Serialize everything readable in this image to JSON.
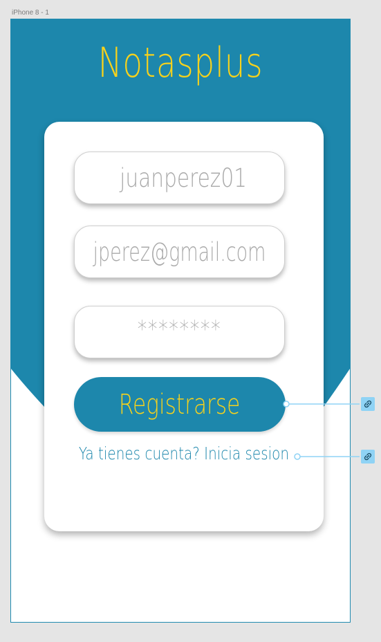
{
  "frame": {
    "label": "iPhone 8 - 1"
  },
  "app": {
    "title": "Notasplus"
  },
  "form": {
    "username_value": "juanperez01",
    "email_value": "jperez@gmail.com",
    "password_value": "********"
  },
  "actions": {
    "register_label": "Registrarse",
    "login_link_label": "Ya tienes cuenta? Inicia sesion"
  },
  "colors": {
    "primary": "#1d87ac",
    "accent": "#f7d21c",
    "field_text": "#a9a9a9",
    "prototype_link": "#8fd3f5"
  },
  "icons": {
    "prototype_link_icon": "link-icon"
  }
}
